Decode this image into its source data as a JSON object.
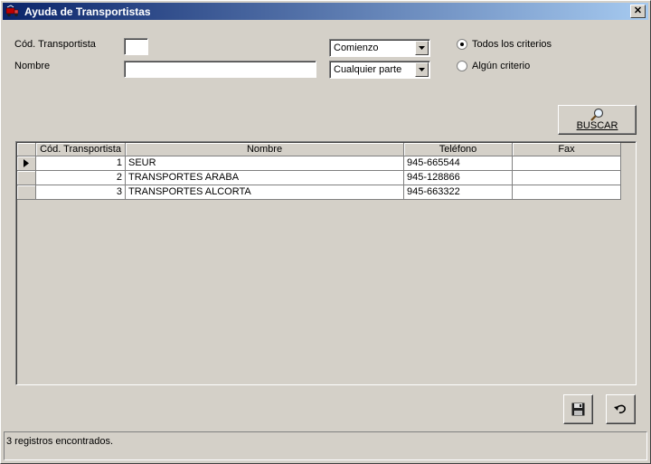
{
  "window": {
    "title": "Ayuda de Transportistas",
    "close_label": "✕"
  },
  "filters": {
    "cod_label": "Cód. Transportista",
    "cod_value": "",
    "nombre_label": "Nombre",
    "nombre_value": "",
    "cod_match": "Comienzo",
    "nombre_match": "Cualquier parte"
  },
  "criteria": {
    "all_label": "Todos los criterios",
    "any_label": "Algún criterio",
    "selected": "all"
  },
  "search_button": {
    "label": "BUSCAR",
    "icon": "magnifier-icon"
  },
  "grid": {
    "columns": [
      "Cód. Transportista",
      "Nombre",
      "Teléfono",
      "Fax"
    ],
    "rows": [
      {
        "cod": "1",
        "nombre": "SEUR",
        "telefono": "945-665544",
        "fax": ""
      },
      {
        "cod": "2",
        "nombre": "TRANSPORTES ARABA",
        "telefono": "945-128866",
        "fax": ""
      },
      {
        "cod": "3",
        "nombre": "TRANSPORTES ALCORTA",
        "telefono": "945-663322",
        "fax": ""
      }
    ],
    "current_row": 0
  },
  "actions": {
    "save_icon": "floppy-disk-icon",
    "undo_icon": "undo-arrow-icon"
  },
  "status": {
    "text": "3 registros encontrados."
  }
}
